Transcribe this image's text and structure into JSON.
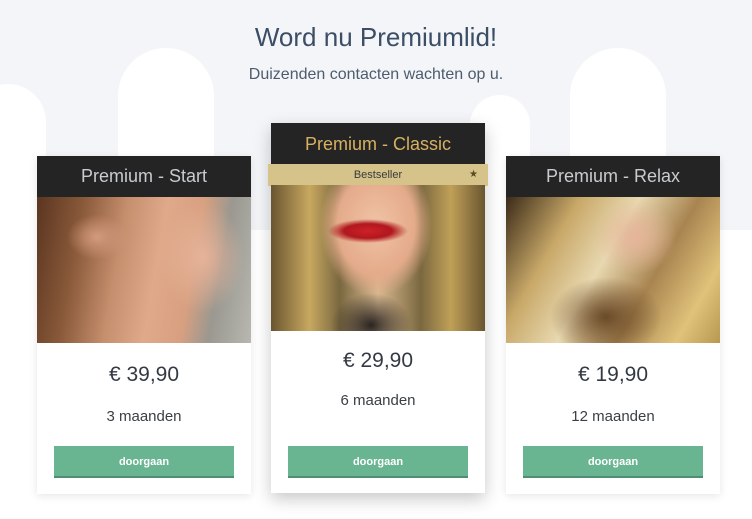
{
  "hero": {
    "title": "Word nu Premiumlid!",
    "subtitle": "Duizenden contacten wachten op u."
  },
  "plans": [
    {
      "name": "Premium - Start",
      "price": "€ 39,90",
      "duration": "3 maanden",
      "button_label": "doorgaan"
    },
    {
      "name": "Premium - Classic",
      "badge": "Bestseller",
      "badge_icon": "star-icon",
      "price": "€ 29,90",
      "duration": "6 maanden",
      "button_label": "doorgaan"
    },
    {
      "name": "Premium - Relax",
      "price": "€ 19,90",
      "duration": "12 maanden",
      "button_label": "doorgaan"
    }
  ],
  "colors": {
    "header_bg": "#242424",
    "highlight_title": "#d6b160",
    "badge_bg": "#d5c38a",
    "button_bg": "#6ab591",
    "title_color": "#3b4e66"
  }
}
